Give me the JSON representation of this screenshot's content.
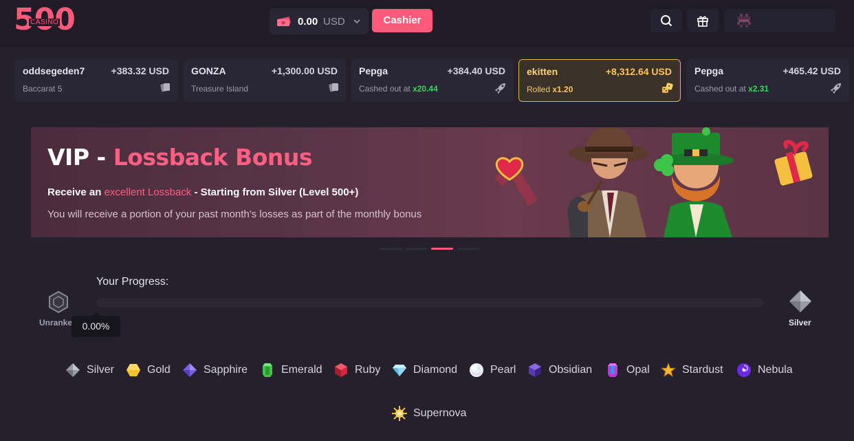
{
  "header": {
    "logo_number": "500",
    "logo_sub": "CASINO",
    "balance_amount": "0.00",
    "balance_currency": "USD",
    "cashier_label": "Cashier"
  },
  "ticker": [
    {
      "user": "oddsegeden7",
      "amount": "+383.32 USD",
      "game": "Baccarat 5",
      "prefix": "",
      "multiplier": "",
      "icon": "cards-icon",
      "highlight": false
    },
    {
      "user": "GONZA",
      "amount": "+1,300.00 USD",
      "game": "Treasure Island",
      "prefix": "",
      "multiplier": "",
      "icon": "cards-icon",
      "highlight": false
    },
    {
      "user": "Pepga",
      "amount": "+384.40 USD",
      "game": "",
      "prefix": "Cashed out at",
      "multiplier": "x20.44",
      "icon": "rocket-icon",
      "highlight": false
    },
    {
      "user": "ekitten",
      "amount": "+8,312.64 USD",
      "game": "",
      "prefix": "Rolled",
      "multiplier": "x1.20",
      "icon": "dice-icon",
      "highlight": true
    },
    {
      "user": "Pepga",
      "amount": "+465.42 USD",
      "game": "",
      "prefix": "Cashed out at",
      "multiplier": "x2.31",
      "icon": "rocket-icon",
      "highlight": false
    }
  ],
  "banner": {
    "title_prefix": "VIP - ",
    "title_accent": "Lossback Bonus",
    "line1_before": "Receive an ",
    "line1_accent": "excellent Lossback",
    "line1_after": " - Starting from Silver (Level 500+)",
    "line2": "You will receive a portion of your past month's losses as part of the monthly bonus",
    "active_slide": 3,
    "slide_count": 4
  },
  "progress": {
    "label": "Your Progress:",
    "percent_text": "0.00%",
    "percent": 0,
    "from_rank": "Unranked",
    "to_rank": "Silver"
  },
  "ranks": [
    {
      "name": "Silver",
      "icon": "silver-diamond-icon",
      "color": "#b8b8c0"
    },
    {
      "name": "Gold",
      "icon": "gold-hexagon-icon",
      "color": "#f2c230"
    },
    {
      "name": "Sapphire",
      "icon": "sapphire-icon",
      "color": "#8a6cf0"
    },
    {
      "name": "Emerald",
      "icon": "emerald-icon",
      "color": "#3fc44a"
    },
    {
      "name": "Ruby",
      "icon": "ruby-icon",
      "color": "#e0304a"
    },
    {
      "name": "Diamond",
      "icon": "diamond-icon",
      "color": "#8fd8f5"
    },
    {
      "name": "Pearl",
      "icon": "pearl-icon",
      "color": "#e8f0f5"
    },
    {
      "name": "Obsidian",
      "icon": "obsidian-icon",
      "color": "#6a4ac0"
    },
    {
      "name": "Opal",
      "icon": "opal-icon",
      "color": "#c04ad0"
    },
    {
      "name": "Stardust",
      "icon": "stardust-icon",
      "color": "#f2b830"
    },
    {
      "name": "Nebula",
      "icon": "nebula-icon",
      "color": "#8a3af0"
    },
    {
      "name": "Supernova",
      "icon": "supernova-icon",
      "color": "#f5c040"
    }
  ]
}
